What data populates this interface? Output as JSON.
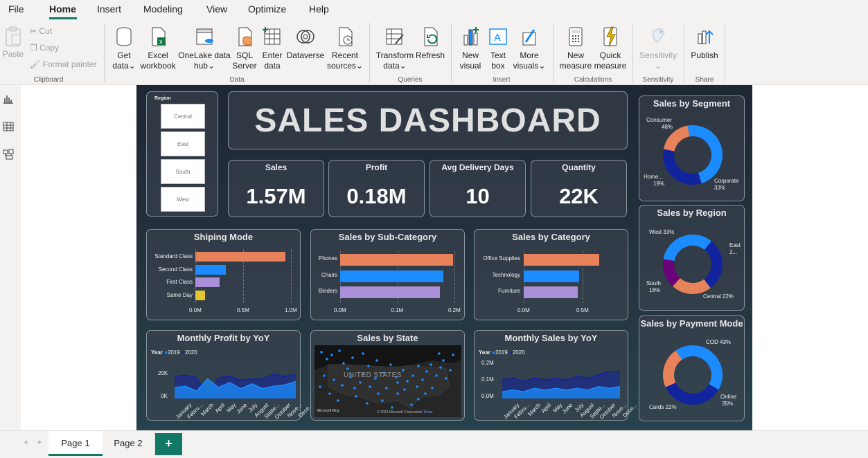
{
  "menu": {
    "tabs": [
      "File",
      "Home",
      "Insert",
      "Modeling",
      "View",
      "Optimize",
      "Help"
    ]
  },
  "ribbon": {
    "clipboard": {
      "paste": "Paste",
      "cut": "Cut",
      "copy": "Copy",
      "format_painter": "Format painter",
      "group": "Clipboard"
    },
    "data": {
      "get_data": "Get",
      "get_data2": "data",
      "excel": "Excel",
      "excel2": "workbook",
      "onelake": "OneLake data",
      "onelake2": "hub",
      "sql": "SQL",
      "sql2": "Server",
      "enter": "Enter",
      "enter2": "data",
      "dataverse": "Dataverse",
      "recent": "Recent",
      "recent2": "sources",
      "group": "Data"
    },
    "queries": {
      "transform": "Transform",
      "transform2": "data",
      "refresh": "Refresh",
      "group": "Queries"
    },
    "insert": {
      "new_visual": "New",
      "new_visual2": "visual",
      "text_box": "Text",
      "text_box2": "box",
      "more_visuals": "More",
      "more_visuals2": "visuals",
      "group": "Insert"
    },
    "calculations": {
      "new_measure": "New",
      "new_measure2": "measure",
      "quick_measure": "Quick",
      "quick_measure2": "measure",
      "group": "Calculations"
    },
    "sensitivity": {
      "label": "Sensitivity",
      "group": "Sensitivity"
    },
    "share": {
      "publish": "Publish",
      "group": "Share"
    }
  },
  "dashboard": {
    "title": "SALES DASHBOARD",
    "slicer": {
      "title": "Region",
      "items": [
        "Central",
        "East",
        "South",
        "West"
      ]
    },
    "kpis": [
      {
        "label": "Sales",
        "value": "1.57M"
      },
      {
        "label": "Profit",
        "value": "0.18M"
      },
      {
        "label": "Avg Delivery Days",
        "value": "10"
      },
      {
        "label": "Quantity",
        "value": "22K"
      }
    ],
    "shipping": {
      "title": "Shiping Mode",
      "ticks": [
        "0.0M",
        "0.5M",
        "1.0M"
      ]
    },
    "subcat": {
      "title": "Sales by Sub-Category",
      "ticks": [
        "0.0M",
        "0.1M",
        "0.2M"
      ]
    },
    "category": {
      "title": "Sales by Category",
      "ticks": [
        "0.0M",
        "0.5M"
      ]
    },
    "profit_yoy": {
      "title": "Monthly Profit by YoY",
      "legend_title": "Year",
      "y_ticks": [
        "20K",
        "0K"
      ]
    },
    "state": {
      "title": "Sales by State",
      "map_label": "UNITED STATES",
      "bing": "Microsoft Bing",
      "copyright": "© 2023 Microsoft Corporation",
      "terms": "Terms"
    },
    "sales_yoy": {
      "title": "Monthly Sales by YoY",
      "legend_title": "Year",
      "y_ticks": [
        "0.2M",
        "0.1M",
        "0.0M"
      ]
    },
    "segment": {
      "title": "Sales by Segment",
      "labels": [
        "Consumer",
        "48%",
        "Home...",
        "19%",
        "Corporate",
        "33%"
      ]
    },
    "region": {
      "title": "Sales by Region",
      "labels": [
        "West 33%",
        "East",
        "2...",
        "South",
        "16%",
        "Central 22%"
      ]
    },
    "payment": {
      "title": "Sales by Payment Mode",
      "labels": [
        "COD 43%",
        "Online",
        "35%",
        "Cards 22%"
      ]
    },
    "months": [
      "January",
      "Febru...",
      "March",
      "April",
      "May",
      "June",
      "July",
      "August",
      "Septe...",
      "October",
      "Nove...",
      "Dece..."
    ]
  },
  "pages": {
    "tabs": [
      "Page 1",
      "Page 2"
    ],
    "add": "+"
  },
  "colors": {
    "accent": "#117865",
    "orange": "#e8825a",
    "blue": "#1a8cff",
    "purple": "#a98fd8",
    "navy": "#12239e",
    "yellow": "#e6c532",
    "dark_purple": "#6b007b"
  },
  "chart_data": [
    {
      "type": "bar",
      "title": "Shiping Mode",
      "categories": [
        "Standard Class",
        "Second Class",
        "First Class",
        "Same Day"
      ],
      "values": [
        0.94,
        0.32,
        0.25,
        0.1
      ],
      "xlim": [
        0,
        1.0
      ],
      "unit": "M"
    },
    {
      "type": "bar",
      "title": "Sales by Sub-Category",
      "categories": [
        "Phones",
        "Chairs",
        "Binders"
      ],
      "values": [
        0.197,
        0.181,
        0.174
      ],
      "xlim": [
        0,
        0.2
      ],
      "unit": "M"
    },
    {
      "type": "bar",
      "title": "Sales by Category",
      "categories": [
        "Office Supplies",
        "Technology",
        "Furniture"
      ],
      "values": [
        0.64,
        0.47,
        0.46
      ],
      "xlim": [
        0,
        0.5
      ],
      "unit": "M"
    },
    {
      "type": "area",
      "title": "Monthly Profit by YoY",
      "x": [
        "January",
        "Febru...",
        "March",
        "April",
        "May",
        "June",
        "July",
        "August",
        "Septe...",
        "October",
        "Nove...",
        "Dece..."
      ],
      "series": [
        {
          "name": "2019",
          "values": [
            9,
            10,
            6,
            16,
            9,
            13,
            8,
            12,
            8,
            10,
            11,
            14
          ]
        },
        {
          "name": "2020",
          "values": [
            18,
            19,
            17,
            3,
            17,
            18,
            15,
            16,
            16,
            20,
            18,
            20
          ]
        }
      ],
      "yunit": "K"
    },
    {
      "type": "area",
      "title": "Monthly Sales by YoY",
      "x": [
        "January",
        "Febru...",
        "March",
        "April",
        "May",
        "June",
        "July",
        "August",
        "Septe...",
        "October",
        "Nove...",
        "Dece..."
      ],
      "series": [
        {
          "name": "2019",
          "values": [
            0.04,
            0.05,
            0.04,
            0.06,
            0.05,
            0.06,
            0.05,
            0.06,
            0.05,
            0.07,
            0.06,
            0.07
          ]
        },
        {
          "name": "2020",
          "values": [
            0.11,
            0.12,
            0.1,
            0.12,
            0.11,
            0.12,
            0.11,
            0.13,
            0.12,
            0.14,
            0.16,
            0.16
          ]
        }
      ],
      "yunit": "M"
    },
    {
      "type": "pie",
      "title": "Sales by Segment",
      "categories": [
        "Consumer",
        "Corporate",
        "Home Office"
      ],
      "values": [
        48,
        33,
        19
      ]
    },
    {
      "type": "pie",
      "title": "Sales by Region",
      "categories": [
        "West",
        "East",
        "Central",
        "South"
      ],
      "values": [
        33,
        29,
        22,
        16
      ]
    },
    {
      "type": "pie",
      "title": "Sales by Payment Mode",
      "categories": [
        "COD",
        "Online",
        "Cards"
      ],
      "values": [
        43,
        35,
        22
      ]
    }
  ]
}
